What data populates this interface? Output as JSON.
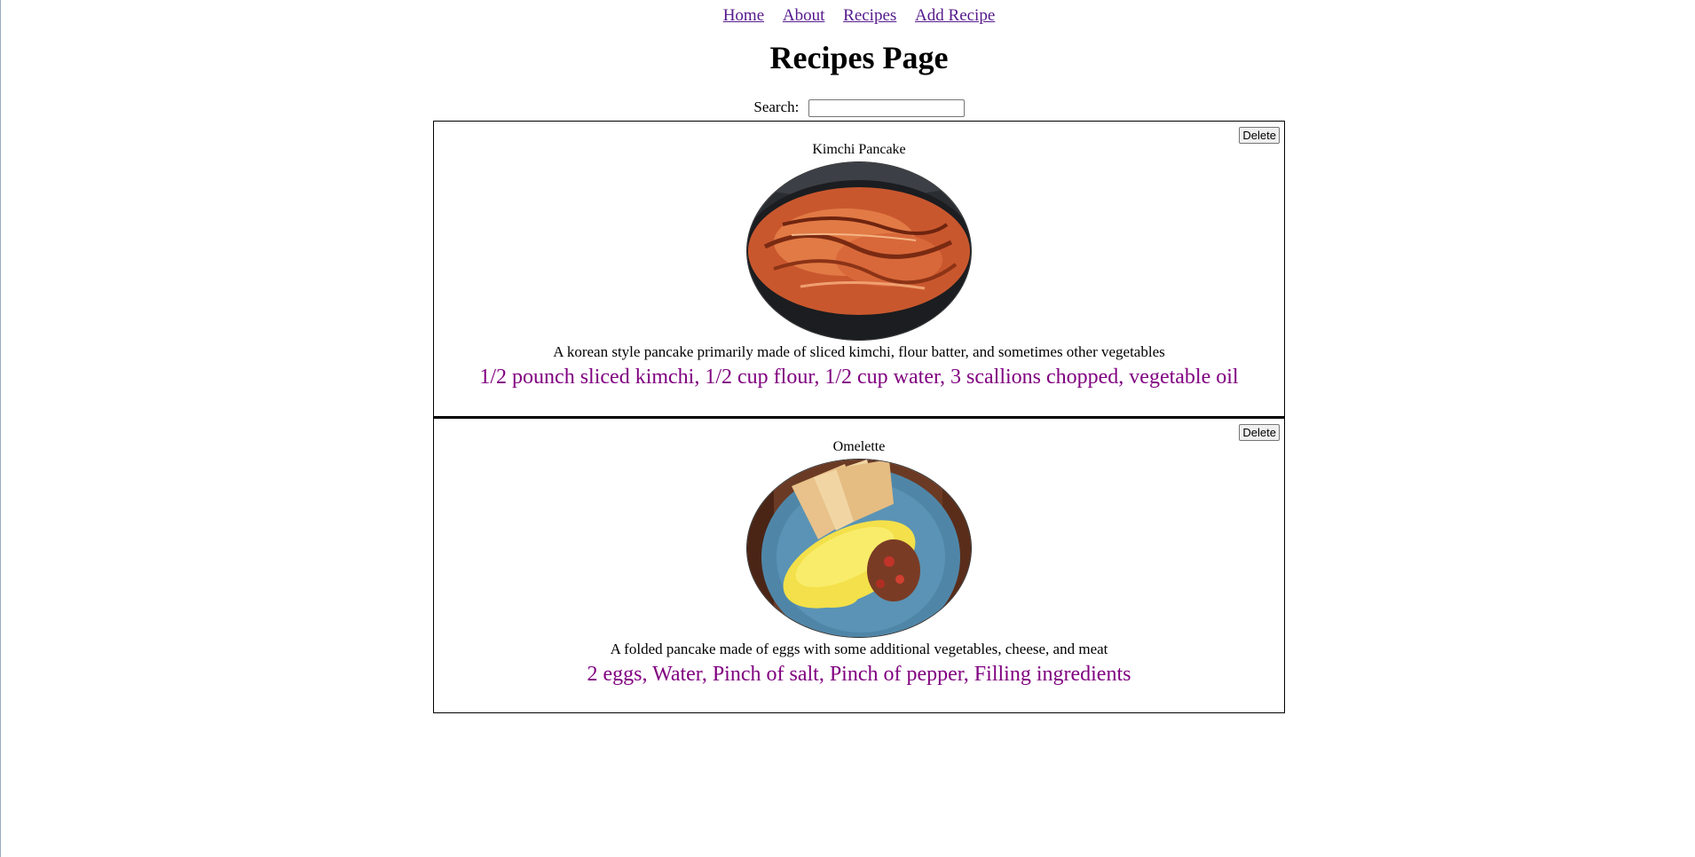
{
  "nav": {
    "links": [
      {
        "label": "Home"
      },
      {
        "label": "About"
      },
      {
        "label": "Recipes"
      },
      {
        "label": "Add Recipe"
      }
    ]
  },
  "page": {
    "title": "Recipes Page"
  },
  "search": {
    "label": "Search:",
    "value": "",
    "placeholder": ""
  },
  "recipes": [
    {
      "name": "Kimchi Pancake",
      "image_icon": "kimchi-pancake-photo",
      "description": "A korean style pancake primarily made of sliced kimchi, flour batter, and sometimes other vegetables",
      "ingredients": "1/2 pounch sliced kimchi, 1/2 cup flour, 1/2 cup water, 3 scallions chopped, vegetable oil",
      "delete_label": "Delete"
    },
    {
      "name": "Omelette",
      "image_icon": "omelette-photo",
      "description": "A folded pancake made of eggs with some additional vegetables, cheese, and meat",
      "ingredients": "2 eggs, Water, Pinch of salt, Pinch of pepper, Filling ingredients",
      "delete_label": "Delete"
    }
  ],
  "colors": {
    "link": "#551a8b",
    "ingredients": "#800080",
    "border": "#000000"
  }
}
